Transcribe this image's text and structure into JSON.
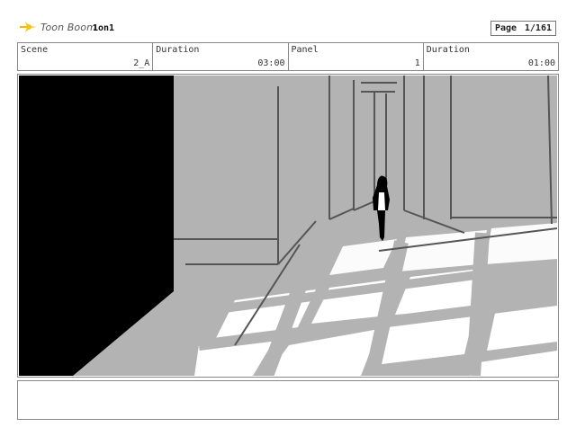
{
  "app": {
    "logo_text": "Toon Boom",
    "project": "1on1"
  },
  "page": {
    "label": "Page",
    "value": "1/161"
  },
  "header": {
    "scene_label": "Scene",
    "scene_value": "2_A",
    "duration1_label": "Duration",
    "duration1_value": "03:00",
    "panel_label": "Panel",
    "panel_value": "1",
    "duration2_label": "Duration",
    "duration2_value": "01:00"
  },
  "panel": {
    "drawing": "storyboard-sketch-hallway-figure"
  },
  "caption": {
    "text": ""
  },
  "colors": {
    "sketch_gray": "#b3b3b3",
    "shadow": "#000000",
    "line": "#555555",
    "frame": "#888888"
  }
}
